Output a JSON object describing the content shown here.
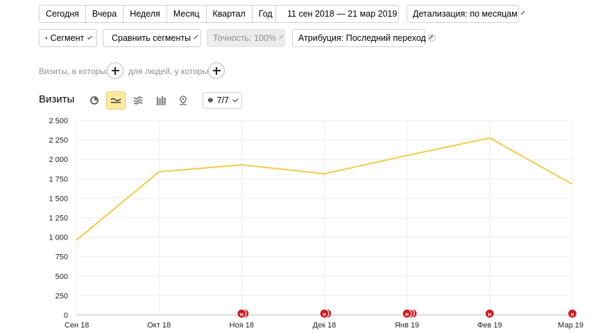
{
  "period_buttons": [
    "Сегодня",
    "Вчера",
    "Неделя",
    "Месяц",
    "Квартал",
    "Год"
  ],
  "date_range": "11 сен 2018 — 21 мар 2019",
  "detail": "Детализация: по месяцам",
  "segment_button": "Сегмент",
  "compare_button": "Сравнить сегменты",
  "accuracy_button": "Точность: 100%",
  "attribution_button": "Атрибуция: Последний переход",
  "help_mark": "?",
  "filter": {
    "visits_hint": "Визиты, в которых",
    "people_hint": "для людей, у которых"
  },
  "chart_title": "Визиты",
  "annotations_button": "7/7",
  "colors": {
    "line": "#f5cb45",
    "marker": "#d2191f",
    "active": "#ffeba0"
  },
  "chart_data": {
    "type": "line",
    "title": "",
    "xlabel": "",
    "ylabel": "",
    "categories": [
      "Сен 18",
      "Окт 18",
      "Ноя 18",
      "Дек 18",
      "Янв 19",
      "Фев 19",
      "Мар 19"
    ],
    "yticks": [
      "0",
      "250",
      "500",
      "750",
      "1 000",
      "1 250",
      "1 500",
      "1 750",
      "2 000",
      "2 250",
      "2 500"
    ],
    "ylim": [
      0,
      2500
    ],
    "grid": true,
    "series": [
      {
        "values": [
          960,
          1840,
          1930,
          1815,
          2050,
          2275,
          1680
        ]
      }
    ],
    "annotations": [
      {
        "x": "Ноя 18",
        "count": 2,
        "label": "н"
      },
      {
        "x": "Дек 18",
        "count": 2,
        "label": "н"
      },
      {
        "x": "Янв 19",
        "count": 3,
        "label": "н"
      },
      {
        "x": "Фев 19",
        "count": 1,
        "label": "н"
      },
      {
        "x": "Мар 19",
        "count": 1,
        "label": "н"
      }
    ]
  }
}
